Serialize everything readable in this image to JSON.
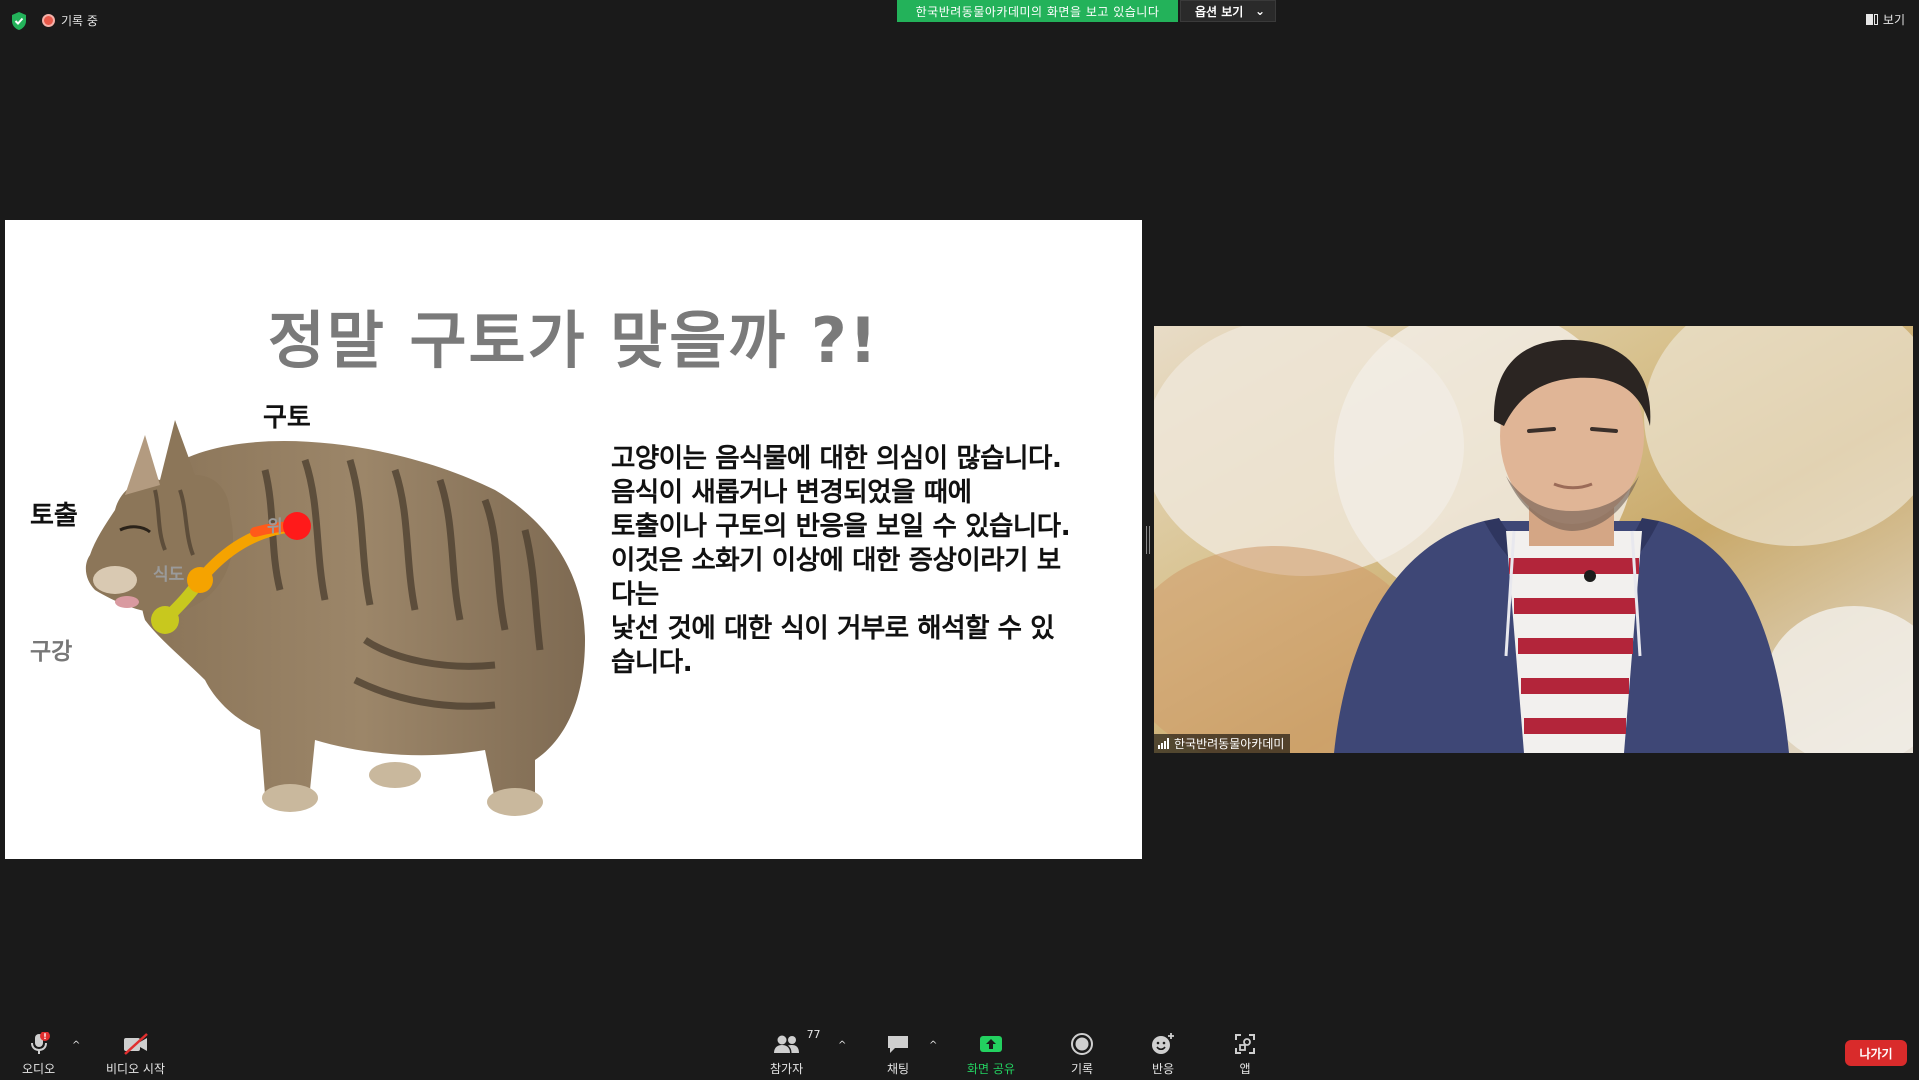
{
  "topbar": {
    "security_icon": "shield-check-icon",
    "recording_label": "기록 중",
    "share_banner": "한국반려동물아카데미의 화면을 보고 있습니다",
    "view_options_label": "옵션 보기",
    "view_options_caret": "⌄",
    "view_label": "보기"
  },
  "slide": {
    "title": "정말 구토가 맞을까 ?!",
    "labels": {
      "vomit": "구토",
      "regurgitation": "토출",
      "mouth": "구강",
      "faint_1": "위",
      "faint_2": "식도"
    },
    "body_lines": [
      "고양이는  음식물에 대한 의심이 많습니다.",
      "음식이 새롭거나 변경되었을 때에",
      "토출이나 구토의 반응을 보일 수 있습니다.",
      "이것은 소화기 이상에 대한 증상이라기 보",
      "다는",
      "낯선 것에 대한 식이 거부로 해석할 수 있",
      "습니다."
    ],
    "colors": {
      "mouth_dot": "#c8c81e",
      "esophagus_dot": "#f5a300",
      "stomach_dot": "#ff1a1a"
    }
  },
  "video": {
    "participant_name": "한국반려동물아카데미"
  },
  "toolbar": {
    "audio_label": "오디오",
    "video_label": "비디오 시작",
    "participants_label": "참가자",
    "participants_count": "77",
    "chat_label": "채팅",
    "share_label": "화면 공유",
    "record_label": "기록",
    "reactions_label": "반응",
    "apps_label": "앱",
    "leave_label": "나가기",
    "accent_green": "#23d160",
    "leave_red": "#d92b2b"
  }
}
